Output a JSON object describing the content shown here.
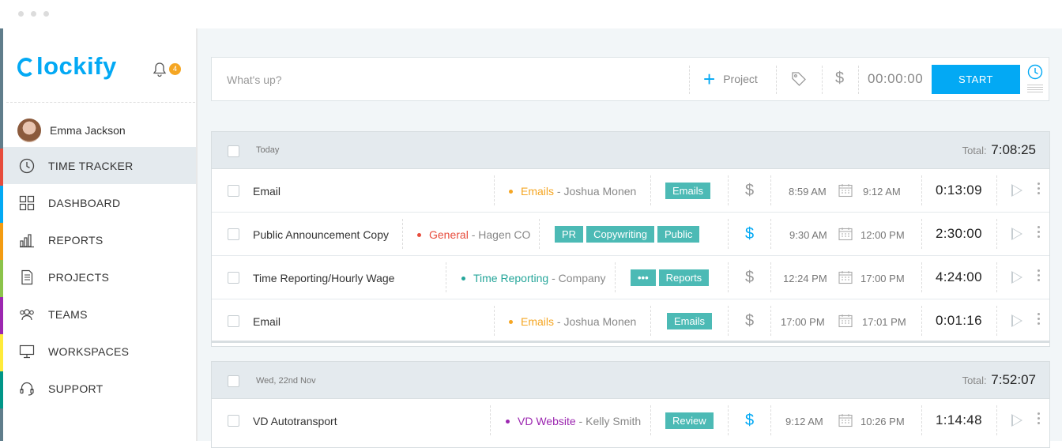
{
  "sidebar": {
    "logo": "lockify",
    "notification_count": "4",
    "user_name": "Emma Jackson",
    "items": [
      {
        "label": "TIME TRACKER",
        "icon": "clock-icon",
        "color": "#e74c3c",
        "active": true
      },
      {
        "label": "DASHBOARD",
        "icon": "grid-icon",
        "color": "#03a9f4"
      },
      {
        "label": "REPORTS",
        "icon": "bar-chart-icon",
        "color": "#f39c12"
      },
      {
        "label": "PROJECTS",
        "icon": "document-icon",
        "color": "#8bc34a"
      },
      {
        "label": "TEAMS",
        "icon": "users-icon",
        "color": "#9c27b0"
      },
      {
        "label": "WORKSPACES",
        "icon": "monitor-icon",
        "color": "#ffeb3b"
      },
      {
        "label": "SUPPORT",
        "icon": "headset-icon",
        "color": "#009688"
      }
    ]
  },
  "timer": {
    "placeholder": "What's up?",
    "project_label": "Project",
    "elapsed": "00:00:00",
    "start_label": "START"
  },
  "groups": [
    {
      "day": "Today",
      "total_label": "Total:",
      "total": "7:08:25",
      "entries": [
        {
          "description": "Email",
          "project": "Emails",
          "project_color": "#f5a623",
          "client": "Joshua Monen",
          "tags": [
            "Emails"
          ],
          "billable": false,
          "start": "8:59 AM",
          "end": "9:12 AM",
          "duration": "0:13:09"
        },
        {
          "description": "Public Announcement Copy",
          "project": "General",
          "project_color": "#e74c3c",
          "client": "Hagen CO",
          "tags": [
            "PR",
            "Copywriting",
            "Public"
          ],
          "billable": true,
          "start": "9:30 AM",
          "end": "12:00 PM",
          "duration": "2:30:00"
        },
        {
          "description": "Time Reporting/Hourly Wage",
          "project": "Time Reporting",
          "project_color": "#26a69a",
          "client": "Company",
          "tags": [
            "•••",
            "Reports"
          ],
          "billable": false,
          "start": "12:24 PM",
          "end": "17:00 PM",
          "duration": "4:24:00"
        },
        {
          "description": "Email",
          "project": "Emails",
          "project_color": "#f5a623",
          "client": "Joshua Monen",
          "tags": [
            "Emails"
          ],
          "billable": false,
          "start": "17:00 PM",
          "end": "17:01 PM",
          "duration": "0:01:16"
        }
      ]
    },
    {
      "day": "Wed, 22nd Nov",
      "total_label": "Total:",
      "total": "7:52:07",
      "entries": [
        {
          "description": "VD Autotransport",
          "project": "VD Website",
          "project_color": "#9c27b0",
          "client": "Kelly Smith",
          "tags": [
            "Review"
          ],
          "billable": true,
          "start": "9:12 AM",
          "end": "10:26 PM",
          "duration": "1:14:48"
        }
      ]
    }
  ]
}
